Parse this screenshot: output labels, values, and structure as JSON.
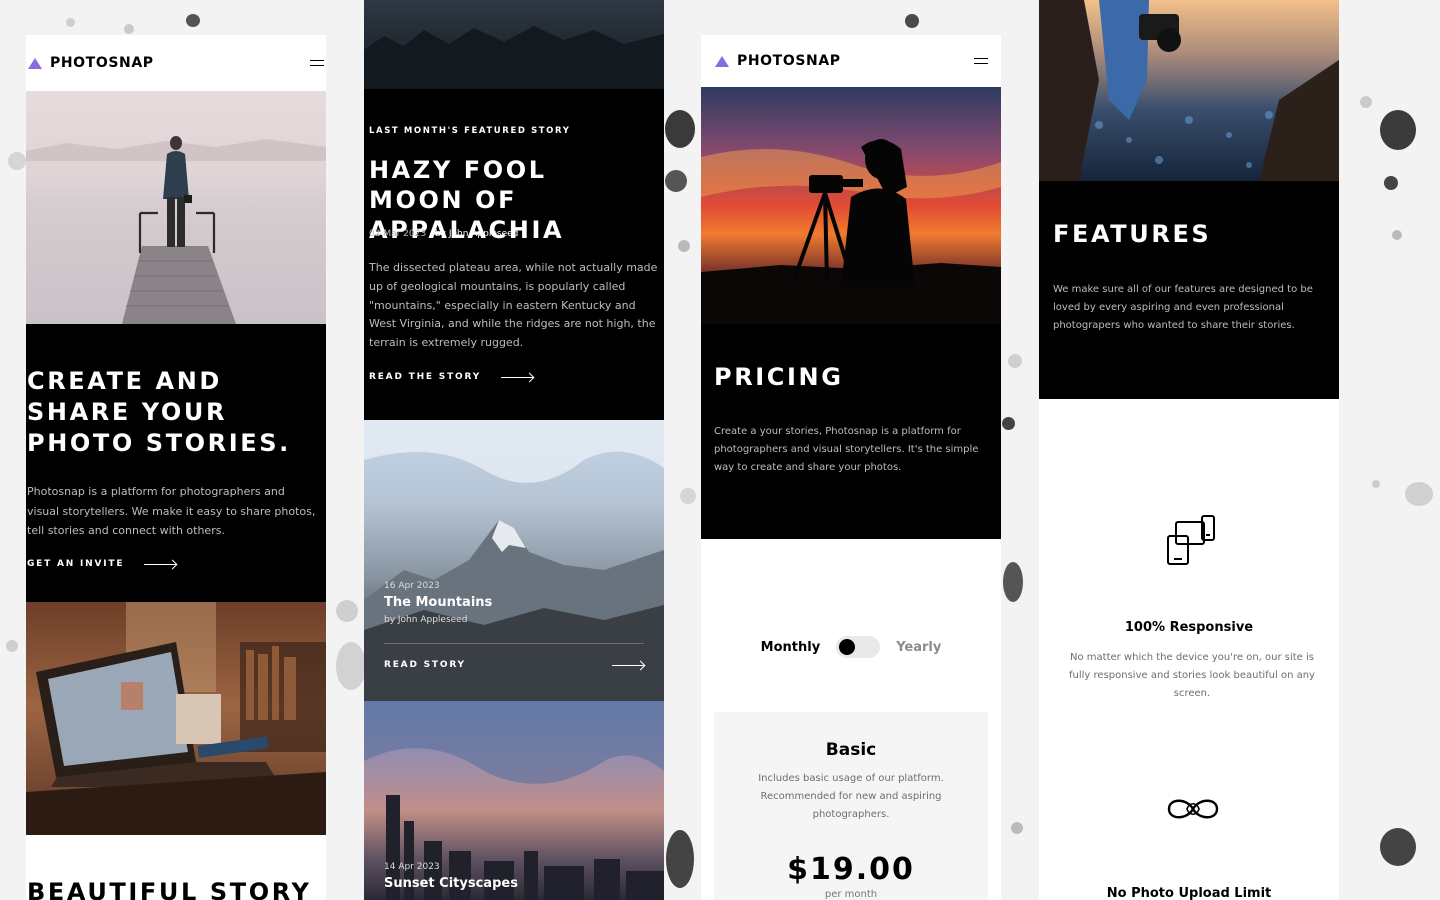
{
  "colors": {
    "accent_gradient": [
      "#ffc593",
      "#bc7198",
      "#5a77ff"
    ],
    "background": "#f3f3f3",
    "panel_black": "#000000",
    "text_muted": "#6e6e6e"
  },
  "screen1": {
    "logo": "PHOTOSNAP",
    "menu_icon": "hamburger-icon",
    "hero_title": "CREATE AND SHARE YOUR PHOTO STORIES.",
    "hero_text": "Photosnap is a platform for photographers and visual storytellers. We make it easy to share photos, tell stories and connect with others.",
    "hero_cta": "GET AN INVITE",
    "next_title": "BEAUTIFUL STORY"
  },
  "screen2": {
    "eyebrow": "LAST MONTH'S FEATURED STORY",
    "title": "HAZY FOOL MOON OF APPALACHIA",
    "date": "02 Mar 2023",
    "author": "by John Appleseed",
    "text": "The dissected plateau area, while not actually made up of geological mountains, is popularly called \"mountains,\" especially in eastern Kentucky and West Virginia, and while the ridges are not high, the terrain is extremely rugged.",
    "cta": "READ THE STORY",
    "stories": [
      {
        "date": "16 Apr 2023",
        "title": "The Mountains",
        "author": "by John Appleseed",
        "cta": "READ STORY"
      },
      {
        "date": "14 Apr 2023",
        "title": "Sunset Cityscapes"
      }
    ]
  },
  "screen3": {
    "logo": "PHOTOSNAP",
    "menu_icon": "hamburger-icon",
    "title": "PRICING",
    "text": "Create a your stories, Photosnap is a platform for photographers and visual storytellers. It's the simple way to create and share your photos.",
    "toggle": {
      "left": "Monthly",
      "right": "Yearly",
      "selected": "Monthly"
    },
    "plan": {
      "name": "Basic",
      "description": "Includes basic usage of our platform. Recommended for new and aspiring photographers.",
      "price": "$19.00",
      "period": "per month"
    }
  },
  "screen4": {
    "title": "FEATURES",
    "text": "We make sure all of our features are designed to be loved by every aspiring and even professional photograpers who wanted to share their stories.",
    "features": [
      {
        "icon": "responsive-devices-icon",
        "title": "100% Responsive",
        "text": "No matter which the device you're on, our site is fully responsive and stories look beautiful on any screen."
      },
      {
        "icon": "infinity-icon",
        "title": "No Photo Upload Limit"
      }
    ]
  }
}
